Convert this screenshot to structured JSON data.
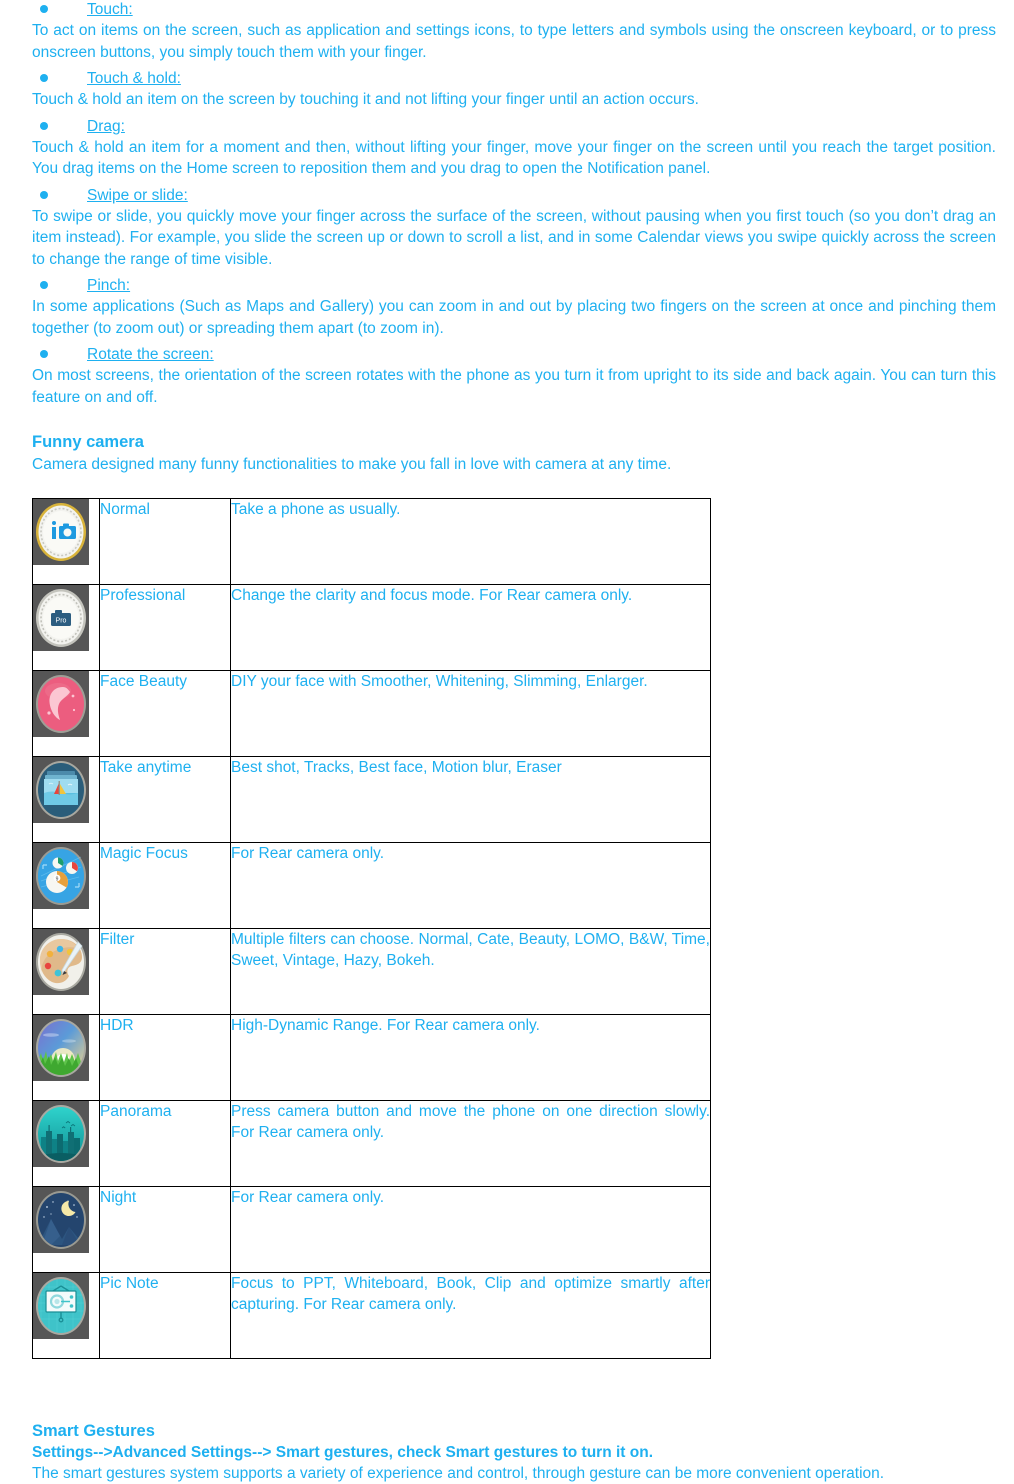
{
  "theme": {
    "text_color": "#1eb0f0",
    "page_background": "#ffffff",
    "table_border": "#000000",
    "icon_tile_background": "#565656"
  },
  "gestures": [
    {
      "term": "Touch:",
      "body": "To act on items on the screen, such as application and settings icons, to type letters and symbols using the onscreen keyboard, or to press onscreen buttons, you simply touch them with your finger."
    },
    {
      "term": "Touch & hold:",
      "body": "Touch & hold an item on the screen by touching it and not lifting your finger until an action occurs."
    },
    {
      "term": "Drag:",
      "body": "Touch & hold an item for a moment and then, without lifting your finger, move your finger on the screen until you reach the target position. You drag items on the Home screen to reposition them and you drag to open the Notification panel."
    },
    {
      "term": "Swipe or slide:",
      "body": "To swipe or slide, you quickly move your finger across the surface of the screen, without pausing when you first touch (so you don’t drag an item instead). For example, you slide the screen up or down to scroll a list, and in some Calendar views you swipe quickly across the screen to change the range of time visible."
    },
    {
      "term": "Pinch:",
      "body": "In some applications (Such as Maps and Gallery) you can zoom in and out by placing two fingers on the screen at once and pinching them together (to zoom out) or spreading them apart (to zoom in)."
    },
    {
      "term": "Rotate the screen:",
      "body": "On most screens, the orientation of the screen rotates with the phone as you turn it from upright to its side and back again. You can turn this feature on and off."
    }
  ],
  "funny_camera": {
    "title": "Funny camera",
    "subtitle": "Camera designed many funny functionalities to make you fall in love with camera at any time.",
    "rows": [
      {
        "icon": "camera-normal-icon",
        "name": "Normal",
        "description": "Take a phone as usually."
      },
      {
        "icon": "camera-professional-icon",
        "name": "Professional",
        "description": "Change the clarity and focus mode. For Rear camera only."
      },
      {
        "icon": "face-beauty-icon",
        "name": "Face Beauty",
        "description": "DIY your face with Smoother, Whitening, Slimming, Enlarger."
      },
      {
        "icon": "take-anytime-icon",
        "name": "Take anytime",
        "description": "Best shot, Tracks, Best face, Motion blur, Eraser"
      },
      {
        "icon": "magic-focus-icon",
        "name": "Magic Focus",
        "description": "For Rear camera only."
      },
      {
        "icon": "filter-palette-icon",
        "name": "Filter",
        "description": "Multiple filters can choose. Normal, Cate, Beauty, LOMO, B&W, Time, Sweet, Vintage, Hazy, Bokeh."
      },
      {
        "icon": "hdr-sunrise-icon",
        "name": "HDR",
        "description": "High-Dynamic Range. For Rear camera only."
      },
      {
        "icon": "panorama-skyline-icon",
        "name": "Panorama",
        "description": "Press camera button and move the phone on one direction slowly. For Rear camera only."
      },
      {
        "icon": "night-moon-icon",
        "name": "Night",
        "description": "For Rear camera only."
      },
      {
        "icon": "pic-note-whiteboard-icon",
        "name": "Pic Note",
        "description": "Focus to PPT, Whiteboard, Book, Clip and optimize smartly after capturing. For Rear camera only."
      }
    ]
  },
  "smart_gestures": {
    "title": "Smart Gestures",
    "path": "Settings-->Advanced Settings--> Smart gestures, check Smart gestures to turn it on.",
    "body": "The smart gestures system supports a variety of experience and control, through gesture can be more convenient operation."
  }
}
